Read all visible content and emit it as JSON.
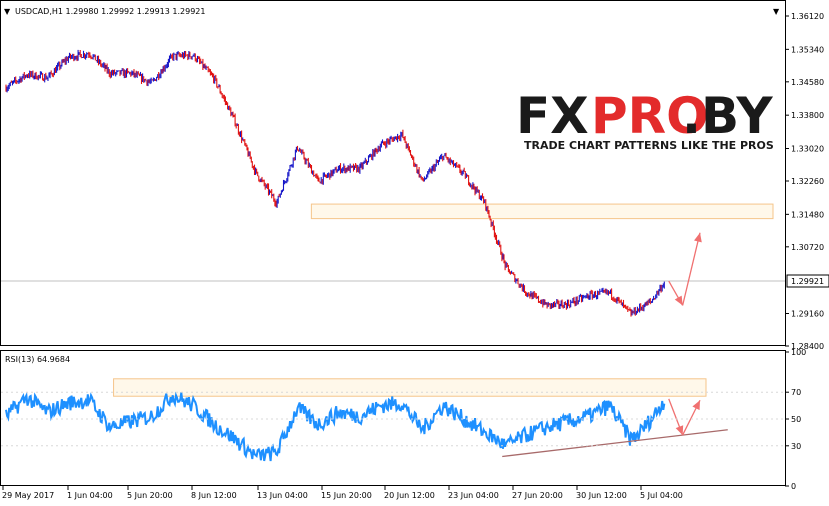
{
  "header": {
    "main_label": "USDCAD,H1  1.29980 1.29992 1.29913 1.29921",
    "rsi_label": "RSI(13) 64.9684",
    "current_price": "1.29921"
  },
  "logo": {
    "fx": "FX",
    "pro": "PRO",
    "dot_by": ".BY",
    "tagline": "TRADE CHART PATTERNS LIKE THE PROS"
  },
  "colors": {
    "bull": "#1414c8",
    "bear": "#e01010",
    "rsi": "#1e90ff",
    "zone_border": "#f5c58a",
    "zone_fill": "#fff8ea",
    "arrow": "#f07070",
    "trendline": "#a86a6a",
    "logo_dark": "#1a1a1a",
    "logo_red": "#e32b2b"
  },
  "chart_data": [
    {
      "type": "candlestick",
      "symbol": "USDCAD",
      "timeframe": "H1",
      "ylim": [
        1.284,
        1.3612
      ],
      "y_ticks": [
        "1.36120",
        "1.35340",
        "1.34580",
        "1.33800",
        "1.33020",
        "1.32260",
        "1.31480",
        "1.30720",
        "1.29921",
        "1.29160",
        "1.28400"
      ],
      "x_ticks": [
        "29 May 2017",
        "1 Jun 04:00",
        "5 Jun 20:00",
        "8 Jun 12:00",
        "13 Jun 04:00",
        "15 Jun 20:00",
        "20 Jun 12:00",
        "23 Jun 04:00",
        "27 Jun 20:00",
        "30 Jun 12:00",
        "5 Jul 04:00"
      ],
      "x_range": [
        0,
        10
      ],
      "series": [
        {
          "x": [
            0,
            0.3,
            0.6,
            0.9,
            1.2,
            1.5,
            1.8,
            2.1,
            2.4,
            2.7,
            3.0,
            3.3,
            3.6,
            3.9,
            4.2,
            4.5,
            4.8,
            5.1,
            5.4,
            5.7,
            6.0,
            6.3,
            6.6,
            6.9,
            7.2,
            7.5,
            7.8,
            8.1,
            8.4,
            8.7,
            9.0,
            9.1,
            9.3,
            9.5
          ],
          "y": [
            1.3445,
            1.3475,
            1.3468,
            1.3515,
            1.3525,
            1.3478,
            1.3478,
            1.3455,
            1.3518,
            1.352,
            1.3465,
            1.3365,
            1.3245,
            1.3175,
            1.3305,
            1.3225,
            1.3255,
            1.3255,
            1.331,
            1.3335,
            1.3225,
            1.3285,
            1.3242,
            1.3175,
            1.3025,
            1.2965,
            1.2935,
            1.2938,
            1.2958,
            1.2965,
            1.2915,
            1.2925,
            1.2945,
            1.2992
          ]
        }
      ],
      "annotations": {
        "resistance_zone": [
          1.3138,
          1.3172
        ],
        "projection_path": [
          [
            9.55,
            1.2992
          ],
          [
            9.75,
            1.2935
          ],
          [
            10.0,
            1.3105
          ]
        ]
      }
    },
    {
      "type": "line",
      "name": "RSI(13)",
      "ylim": [
        0,
        100
      ],
      "y_ticks": [
        0,
        30,
        50,
        70,
        100
      ],
      "x_range": [
        0,
        10
      ],
      "series": [
        {
          "x": [
            0,
            0.3,
            0.6,
            0.9,
            1.2,
            1.5,
            1.8,
            2.1,
            2.4,
            2.7,
            3.0,
            3.3,
            3.6,
            3.9,
            4.2,
            4.5,
            4.8,
            5.1,
            5.4,
            5.7,
            6.0,
            6.3,
            6.6,
            6.9,
            7.2,
            7.5,
            7.8,
            8.1,
            8.4,
            8.7,
            9.0,
            9.1,
            9.3,
            9.5
          ],
          "y": [
            52,
            66,
            55,
            62,
            64,
            44,
            48,
            52,
            68,
            60,
            46,
            35,
            22,
            25,
            58,
            46,
            55,
            52,
            60,
            62,
            42,
            60,
            50,
            40,
            30,
            38,
            44,
            48,
            52,
            60,
            35,
            38,
            50,
            65
          ]
        }
      ],
      "annotations": {
        "resistance_zone": [
          67,
          80
        ],
        "support_trendline": [
          [
            7.15,
            22
          ],
          [
            10.4,
            42
          ]
        ],
        "projection_path": [
          [
            9.55,
            65
          ],
          [
            9.75,
            38
          ],
          [
            10.0,
            64
          ]
        ]
      }
    }
  ]
}
